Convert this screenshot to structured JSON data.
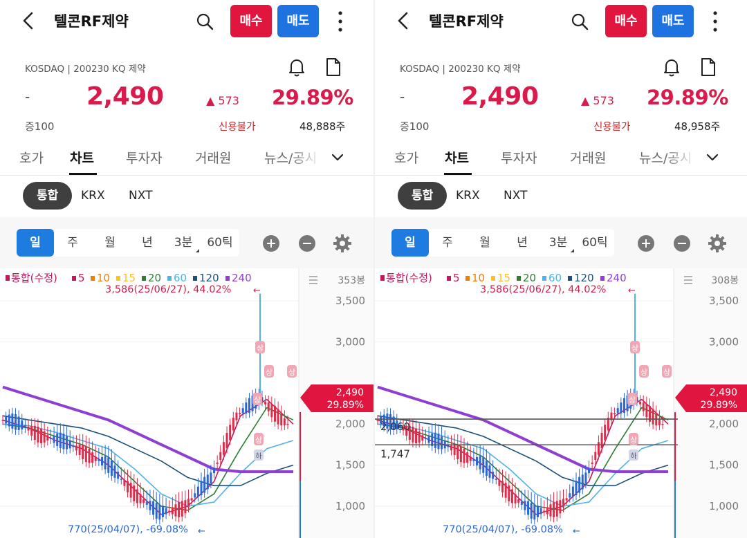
{
  "header": {
    "title": "텔콘RF제약",
    "buy_label": "매수",
    "sell_label": "매도"
  },
  "info": {
    "market": "KOSDAQ | 200230 KQ 제약",
    "dash": "-",
    "price": "2,490",
    "change": "573",
    "percent": "29.89%",
    "margin": "증100",
    "credit": "신용불가"
  },
  "tabs": [
    "호가",
    "차트",
    "투자자",
    "거래원",
    "뉴스/공시"
  ],
  "exchange": [
    "통합",
    "KRX",
    "NXT"
  ],
  "periods": [
    "일",
    "주",
    "월",
    "년",
    "3분",
    "60틱"
  ],
  "legend": {
    "main": "통합(수정)",
    "ma": [
      "5",
      "10",
      "15",
      "20",
      "60",
      "120",
      "240"
    ]
  },
  "annotations": {
    "high": "3,586(25/06/27), 44.02%",
    "low": "770(25/04/07), -69.08%",
    "limit_up": "상",
    "liquidation": "하"
  },
  "price_tag": {
    "price": "2,490",
    "percent": "29.89%"
  },
  "y_ticks": [
    "3,500",
    "3,000",
    "2,000",
    "1,500",
    "1,000"
  ],
  "panels": [
    {
      "volume": "48,888주",
      "bars": "353봉"
    },
    {
      "volume": "48,958주",
      "bars": "308봉",
      "hlines": [
        "2,060",
        "1,747"
      ]
    }
  ],
  "colors": {
    "up": "#d81b4b",
    "buy": "#e0163f",
    "sell": "#1f73e0",
    "ma5": "#c2185b",
    "ma10": "#f57c00",
    "ma15": "#fbc02d",
    "ma20": "#2e7d32",
    "ma60": "#4fb3e8",
    "ma120": "#1a4f7a",
    "ma240": "#8e3fd1"
  },
  "chart_data": [
    {
      "type": "line",
      "title": "",
      "xlabel": "",
      "ylabel": "",
      "ylim": [
        700,
        3700
      ],
      "y_ticks": [
        1000,
        1500,
        2000,
        3000,
        3500
      ],
      "bars_shown": "353봉",
      "series": [
        {
          "name": "5",
          "values": [
            2050,
            1950,
            1800,
            1700,
            1500,
            1200,
            900,
            1000,
            1300,
            2100,
            2300,
            2000
          ]
        },
        {
          "name": "20",
          "values": [
            2000,
            1950,
            1850,
            1750,
            1600,
            1300,
            1000,
            950,
            1150,
            1700,
            2200,
            2050
          ]
        },
        {
          "name": "60",
          "values": [
            2000,
            1980,
            1900,
            1800,
            1700,
            1450,
            1150,
            1000,
            1050,
            1400,
            1700,
            1800
          ]
        },
        {
          "name": "120",
          "values": [
            2100,
            2050,
            2000,
            1950,
            1850,
            1700,
            1550,
            1350,
            1250,
            1250,
            1400,
            1500
          ]
        },
        {
          "name": "240",
          "values": [
            2450,
            2350,
            2250,
            2150,
            2050,
            1900,
            1750,
            1600,
            1450,
            1420,
            1420,
            1420
          ]
        }
      ],
      "annotations": [
        "3,586(25/06/27), 44.02%",
        "770(25/04/07), -69.08%"
      ]
    },
    {
      "type": "line",
      "title": "",
      "xlabel": "",
      "ylabel": "",
      "ylim": [
        700,
        3700
      ],
      "y_ticks": [
        1000,
        1500,
        2000,
        3000,
        3500
      ],
      "bars_shown": "308봉",
      "horizontal_lines": [
        2060,
        1747
      ],
      "series": [
        {
          "name": "5",
          "values": [
            2050,
            1950,
            1800,
            1700,
            1500,
            1200,
            900,
            1000,
            1300,
            2100,
            2300,
            2000
          ]
        },
        {
          "name": "20",
          "values": [
            2000,
            1950,
            1850,
            1750,
            1600,
            1300,
            1000,
            950,
            1150,
            1700,
            2200,
            2050
          ]
        },
        {
          "name": "60",
          "values": [
            2000,
            1980,
            1900,
            1800,
            1700,
            1450,
            1150,
            1000,
            1050,
            1400,
            1700,
            1800
          ]
        },
        {
          "name": "120",
          "values": [
            2100,
            2050,
            2000,
            1950,
            1850,
            1700,
            1550,
            1350,
            1250,
            1250,
            1400,
            1500
          ]
        },
        {
          "name": "240",
          "values": [
            2450,
            2350,
            2250,
            2150,
            2050,
            1900,
            1750,
            1600,
            1450,
            1420,
            1420,
            1420
          ]
        }
      ],
      "annotations": [
        "3,586(25/06/27), 44.02%",
        "770(25/04/07), -69.08%"
      ]
    }
  ]
}
